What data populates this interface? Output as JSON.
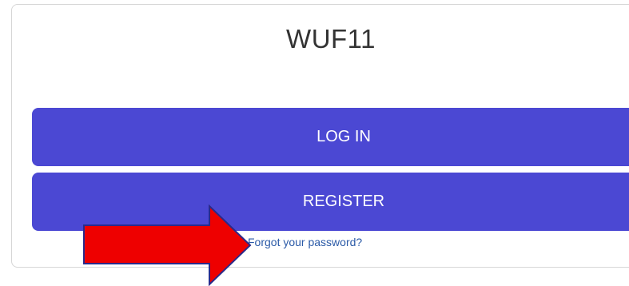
{
  "app": {
    "title": "WUF11"
  },
  "actions": {
    "login_label": "LOG IN",
    "register_label": "REGISTER",
    "forgot_label": "Forgot your password?"
  },
  "annotation": {
    "icon": "red-arrow-icon",
    "color": "#ee0000"
  },
  "colors": {
    "button": "#4b48d3",
    "link": "#2b5aa7"
  }
}
